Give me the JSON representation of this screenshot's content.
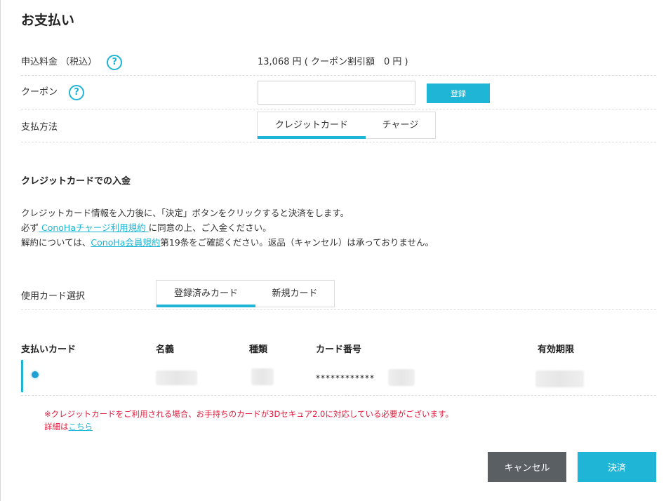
{
  "page": {
    "title": "お支払い"
  },
  "fee": {
    "label": "申込料金 （税込）",
    "value": "13,068 円 ( クーポン割引額　0 円 )"
  },
  "coupon": {
    "label": "クーポン",
    "input_value": "",
    "register_label": "登録"
  },
  "payment_method": {
    "label": "支払方法",
    "tabs": [
      "クレジットカード",
      "チャージ"
    ],
    "active": 0
  },
  "credit_section": {
    "title": "クレジットカードでの入金",
    "line1": "クレジットカード情報を入力後に、「決定」ボタンをクリックすると決済をします。",
    "line2_prefix": "必ず",
    "line2_link": " ConoHaチャージ利用規約 ",
    "line2_suffix": "に同意の上、ご入金ください。",
    "line3_prefix": "解約については、",
    "line3_link": "ConoHa会員規約",
    "line3_suffix": "第19条をご確認ください。返品（キャンセル）は承っておりません。"
  },
  "card_select": {
    "label": "使用カード選択",
    "tabs": [
      "登録済みカード",
      "新規カード"
    ],
    "active": 0
  },
  "table": {
    "headers": [
      "支払いカード",
      "名義",
      "種類",
      "カード番号",
      "有効期限"
    ],
    "rows": [
      {
        "selected": true,
        "card_number": "************"
      }
    ]
  },
  "notice": {
    "text": "※クレジットカードをご利用される場合、お手持ちのカードが3Dセキュア2.0に対応している必要がございます。",
    "detail_prefix": "詳細は",
    "detail_link": "こちら"
  },
  "actions": {
    "cancel_label": "キャンセル",
    "pay_label": "決済"
  },
  "colors": {
    "accent": "#1fb5d6",
    "warning": "#e0193a",
    "cancel_bg": "#5a5f63"
  }
}
